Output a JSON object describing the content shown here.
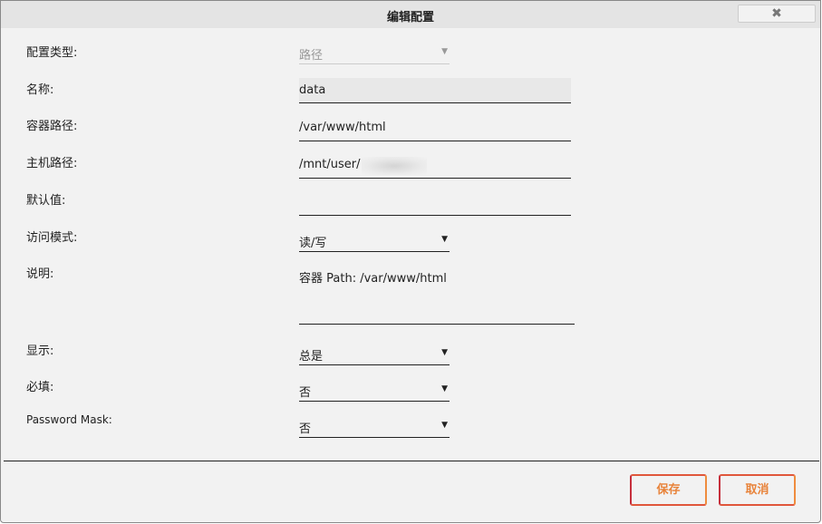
{
  "dialog": {
    "title": "编辑配置",
    "close_icon": "close-icon"
  },
  "fields": {
    "config_type": {
      "label": "配置类型:",
      "value": "路径"
    },
    "name": {
      "label": "名称:",
      "value": "data"
    },
    "container_path": {
      "label": "容器路径:",
      "value": "/var/www/html"
    },
    "host_path": {
      "label": "主机路径:",
      "value": "/mnt/user/"
    },
    "default_value": {
      "label": "默认值:",
      "value": ""
    },
    "access_mode": {
      "label": "访问模式:",
      "value": "读/写"
    },
    "description": {
      "label": "说明:",
      "value": "容器 Path: /var/www/html"
    },
    "display": {
      "label": "显示:",
      "value": "总是"
    },
    "required": {
      "label": "必填:",
      "value": "否"
    },
    "password_mask": {
      "label": "Password Mask:",
      "value": "否"
    }
  },
  "buttons": {
    "save": "保存",
    "cancel": "取消"
  },
  "dropdown_arrow": "▼",
  "close_glyph": "✖"
}
